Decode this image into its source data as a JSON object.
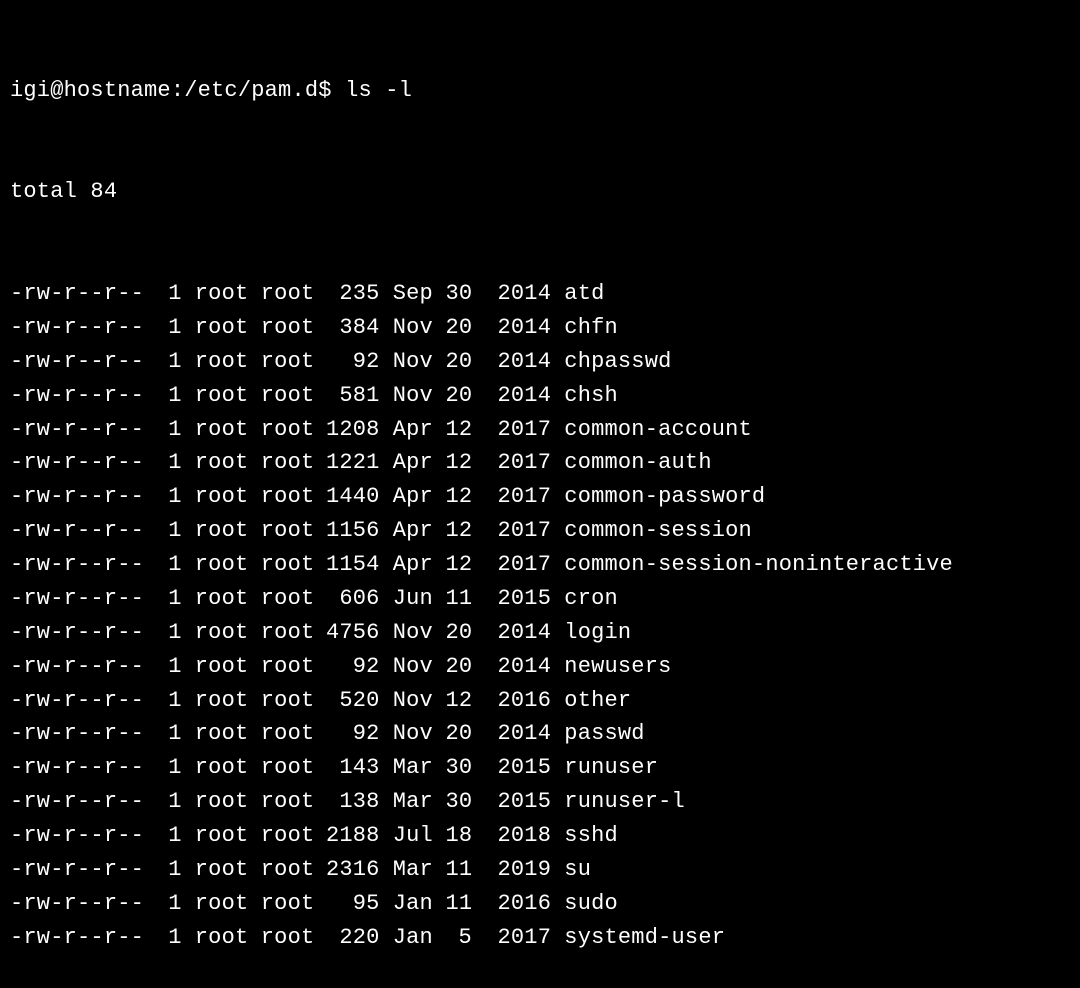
{
  "prompt": {
    "user_host_path": "igi@hostname:/etc/pam.d$",
    "command": "ls -l"
  },
  "total_line": "total 84",
  "files": [
    {
      "perms": "-rw-r--r--",
      "links": "1",
      "owner": "root",
      "group": "root",
      "size": "235",
      "month": "Sep",
      "day": "30",
      "year": "2014",
      "name": "atd"
    },
    {
      "perms": "-rw-r--r--",
      "links": "1",
      "owner": "root",
      "group": "root",
      "size": "384",
      "month": "Nov",
      "day": "20",
      "year": "2014",
      "name": "chfn"
    },
    {
      "perms": "-rw-r--r--",
      "links": "1",
      "owner": "root",
      "group": "root",
      "size": "92",
      "month": "Nov",
      "day": "20",
      "year": "2014",
      "name": "chpasswd"
    },
    {
      "perms": "-rw-r--r--",
      "links": "1",
      "owner": "root",
      "group": "root",
      "size": "581",
      "month": "Nov",
      "day": "20",
      "year": "2014",
      "name": "chsh"
    },
    {
      "perms": "-rw-r--r--",
      "links": "1",
      "owner": "root",
      "group": "root",
      "size": "1208",
      "month": "Apr",
      "day": "12",
      "year": "2017",
      "name": "common-account"
    },
    {
      "perms": "-rw-r--r--",
      "links": "1",
      "owner": "root",
      "group": "root",
      "size": "1221",
      "month": "Apr",
      "day": "12",
      "year": "2017",
      "name": "common-auth"
    },
    {
      "perms": "-rw-r--r--",
      "links": "1",
      "owner": "root",
      "group": "root",
      "size": "1440",
      "month": "Apr",
      "day": "12",
      "year": "2017",
      "name": "common-password"
    },
    {
      "perms": "-rw-r--r--",
      "links": "1",
      "owner": "root",
      "group": "root",
      "size": "1156",
      "month": "Apr",
      "day": "12",
      "year": "2017",
      "name": "common-session"
    },
    {
      "perms": "-rw-r--r--",
      "links": "1",
      "owner": "root",
      "group": "root",
      "size": "1154",
      "month": "Apr",
      "day": "12",
      "year": "2017",
      "name": "common-session-noninteractive"
    },
    {
      "perms": "-rw-r--r--",
      "links": "1",
      "owner": "root",
      "group": "root",
      "size": "606",
      "month": "Jun",
      "day": "11",
      "year": "2015",
      "name": "cron"
    },
    {
      "perms": "-rw-r--r--",
      "links": "1",
      "owner": "root",
      "group": "root",
      "size": "4756",
      "month": "Nov",
      "day": "20",
      "year": "2014",
      "name": "login"
    },
    {
      "perms": "-rw-r--r--",
      "links": "1",
      "owner": "root",
      "group": "root",
      "size": "92",
      "month": "Nov",
      "day": "20",
      "year": "2014",
      "name": "newusers"
    },
    {
      "perms": "-rw-r--r--",
      "links": "1",
      "owner": "root",
      "group": "root",
      "size": "520",
      "month": "Nov",
      "day": "12",
      "year": "2016",
      "name": "other"
    },
    {
      "perms": "-rw-r--r--",
      "links": "1",
      "owner": "root",
      "group": "root",
      "size": "92",
      "month": "Nov",
      "day": "20",
      "year": "2014",
      "name": "passwd"
    },
    {
      "perms": "-rw-r--r--",
      "links": "1",
      "owner": "root",
      "group": "root",
      "size": "143",
      "month": "Mar",
      "day": "30",
      "year": "2015",
      "name": "runuser"
    },
    {
      "perms": "-rw-r--r--",
      "links": "1",
      "owner": "root",
      "group": "root",
      "size": "138",
      "month": "Mar",
      "day": "30",
      "year": "2015",
      "name": "runuser-l"
    },
    {
      "perms": "-rw-r--r--",
      "links": "1",
      "owner": "root",
      "group": "root",
      "size": "2188",
      "month": "Jul",
      "day": "18",
      "year": "2018",
      "name": "sshd"
    },
    {
      "perms": "-rw-r--r--",
      "links": "1",
      "owner": "root",
      "group": "root",
      "size": "2316",
      "month": "Mar",
      "day": "11",
      "year": "2019",
      "name": "su"
    },
    {
      "perms": "-rw-r--r--",
      "links": "1",
      "owner": "root",
      "group": "root",
      "size": "95",
      "month": "Jan",
      "day": "11",
      "year": "2016",
      "name": "sudo"
    },
    {
      "perms": "-rw-r--r--",
      "links": "1",
      "owner": "root",
      "group": "root",
      "size": "220",
      "month": "Jan",
      "day": "5",
      "year": "2017",
      "name": "systemd-user"
    }
  ]
}
